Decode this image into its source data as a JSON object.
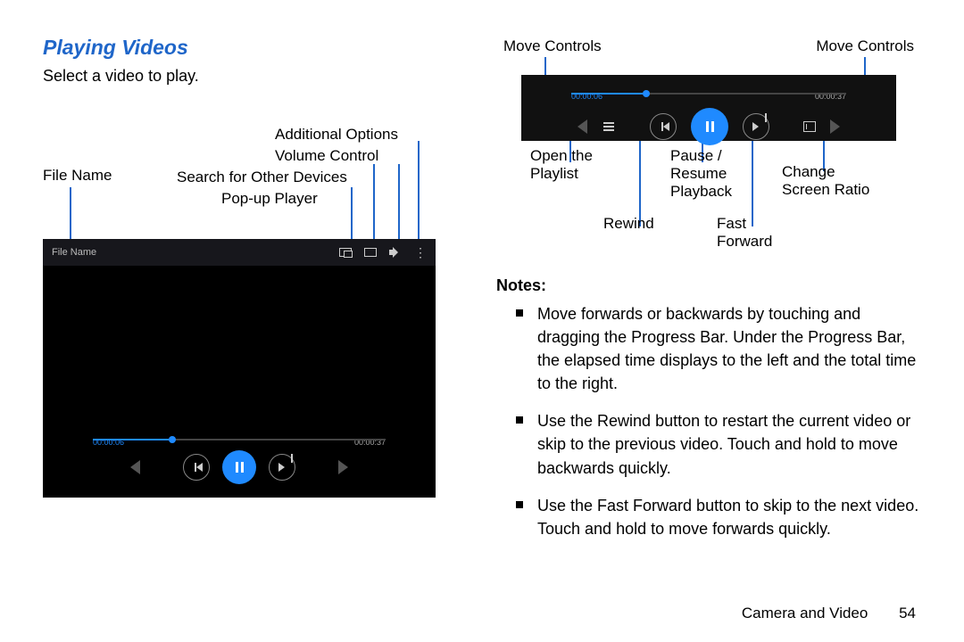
{
  "heading": "Playing Videos",
  "lead": "Select a video to play.",
  "left_callouts": {
    "file_name": "File Name",
    "search": "Search for Other Devices",
    "popup": "Pop-up Player",
    "volume": "Volume Control",
    "additional": "Additional Options"
  },
  "player": {
    "title": "File Name",
    "elapsed": "00:00:06",
    "total": "00:00:37"
  },
  "right_top": {
    "move_left": "Move Controls",
    "move_right": "Move Controls"
  },
  "sm_callouts": {
    "open1": "Open the",
    "open2": "Playlist",
    "pause1": "Pause /",
    "pause2": "Resume",
    "pause3": "Playback",
    "change1": "Change",
    "change2": "Screen Ratio",
    "rewind": "Rewind",
    "ff1": "Fast",
    "ff2": "Forward"
  },
  "notes_heading": "Notes:",
  "notes": [
    "Move forwards or backwards by touching and dragging the Progress Bar. Under the Progress Bar, the elapsed time displays to the left and the total time to the right.",
    "Use the Rewind button to restart the current video or skip to the previous video. Touch and hold to move backwards quickly.",
    "Use the Fast Forward button to skip to the next video. Touch and hold to move forwards quickly."
  ],
  "footer_section": "Camera and Video",
  "footer_page": "54"
}
